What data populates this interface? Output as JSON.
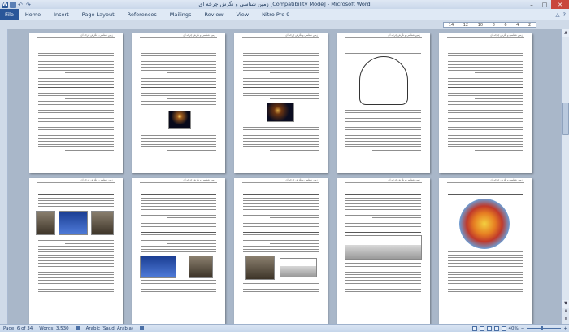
{
  "window": {
    "title": "زمین شناسی و نگرش چرخه ای [Compatibility Mode]  -  Microsoft Word",
    "app_icon": "W",
    "min": "–",
    "max": "□",
    "close": "✕"
  },
  "ribbon": {
    "file": "File",
    "tabs": [
      "Home",
      "Insert",
      "Page Layout",
      "References",
      "Mailings",
      "Review",
      "View",
      "Nitro Pro 9"
    ],
    "right_icons": [
      "△",
      "?"
    ]
  },
  "ruler": {
    "marks": [
      "14",
      "12",
      "10",
      "8",
      "6",
      "4",
      "2"
    ]
  },
  "pages": {
    "header_text": "زمین شناسی و نگرش چرخه ای"
  },
  "scrollbar": {
    "up": "▲",
    "down": "▼",
    "page_up": "⇞",
    "page_down": "⇟"
  },
  "status": {
    "page": "Page: 6 of 34",
    "words": "Words: 3,530",
    "language": "Arabic (Saudi Arabia)",
    "zoom": "40%",
    "zoom_minus": "−",
    "zoom_plus": "+"
  }
}
